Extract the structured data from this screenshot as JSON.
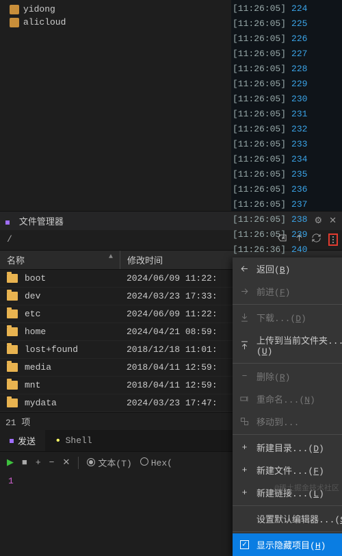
{
  "tree": {
    "items": [
      {
        "label": "yidong"
      },
      {
        "label": "alicloud"
      }
    ]
  },
  "logs": {
    "rows": [
      {
        "time": "[11:26:05]",
        "num": "224"
      },
      {
        "time": "[11:26:05]",
        "num": "225"
      },
      {
        "time": "[11:26:05]",
        "num": "226"
      },
      {
        "time": "[11:26:05]",
        "num": "227"
      },
      {
        "time": "[11:26:05]",
        "num": "228"
      },
      {
        "time": "[11:26:05]",
        "num": "229"
      },
      {
        "time": "[11:26:05]",
        "num": "230"
      },
      {
        "time": "[11:26:05]",
        "num": "231"
      },
      {
        "time": "[11:26:05]",
        "num": "232"
      },
      {
        "time": "[11:26:05]",
        "num": "233"
      },
      {
        "time": "[11:26:05]",
        "num": "234"
      },
      {
        "time": "[11:26:05]",
        "num": "235"
      },
      {
        "time": "[11:26:05]",
        "num": "236"
      },
      {
        "time": "[11:26:05]",
        "num": "237"
      },
      {
        "time": "[11:26:05]",
        "num": "238"
      },
      {
        "time": "[11:26:05]",
        "num": "239"
      },
      {
        "time": "[11:26:36]",
        "num": "240"
      }
    ]
  },
  "fm": {
    "title": "文件管理器",
    "path": "/",
    "cols": {
      "name": "名称",
      "mtime": "修改时间"
    },
    "rows": [
      {
        "name": "boot",
        "mtime": "2024/06/09 11:22:"
      },
      {
        "name": "dev",
        "mtime": "2024/03/23 17:33:"
      },
      {
        "name": "etc",
        "mtime": "2024/06/09 11:22:"
      },
      {
        "name": "home",
        "mtime": "2024/04/21 08:59:"
      },
      {
        "name": "lost+found",
        "mtime": "2018/12/18 11:01:"
      },
      {
        "name": "media",
        "mtime": "2018/04/11 12:59:"
      },
      {
        "name": "mnt",
        "mtime": "2018/04/11 12:59:"
      },
      {
        "name": "mydata",
        "mtime": "2024/03/23 17:47:"
      }
    ],
    "status": "21 项"
  },
  "tabs": {
    "send": "发送",
    "shell": "Shell"
  },
  "toolbar": {
    "text": "文本(T)",
    "hex": "Hex("
  },
  "bottom_num": "1",
  "ctx": {
    "back": "返回(B)",
    "forward": "前进(F)",
    "download": "下载...(D)",
    "upload": "上传到当前文件夹...(U)",
    "delete": "删除(R)",
    "rename": "重命名...(N)",
    "move": "移动到...",
    "newdir": "新建目录...(D)",
    "newfile": "新建文件...(F)",
    "newlink": "新建链接...(L)",
    "editor": "设置默认编辑器...(S)",
    "showhidden": "显示隐藏项目(H)"
  },
  "watermark": "@稀土掘金技术社区"
}
